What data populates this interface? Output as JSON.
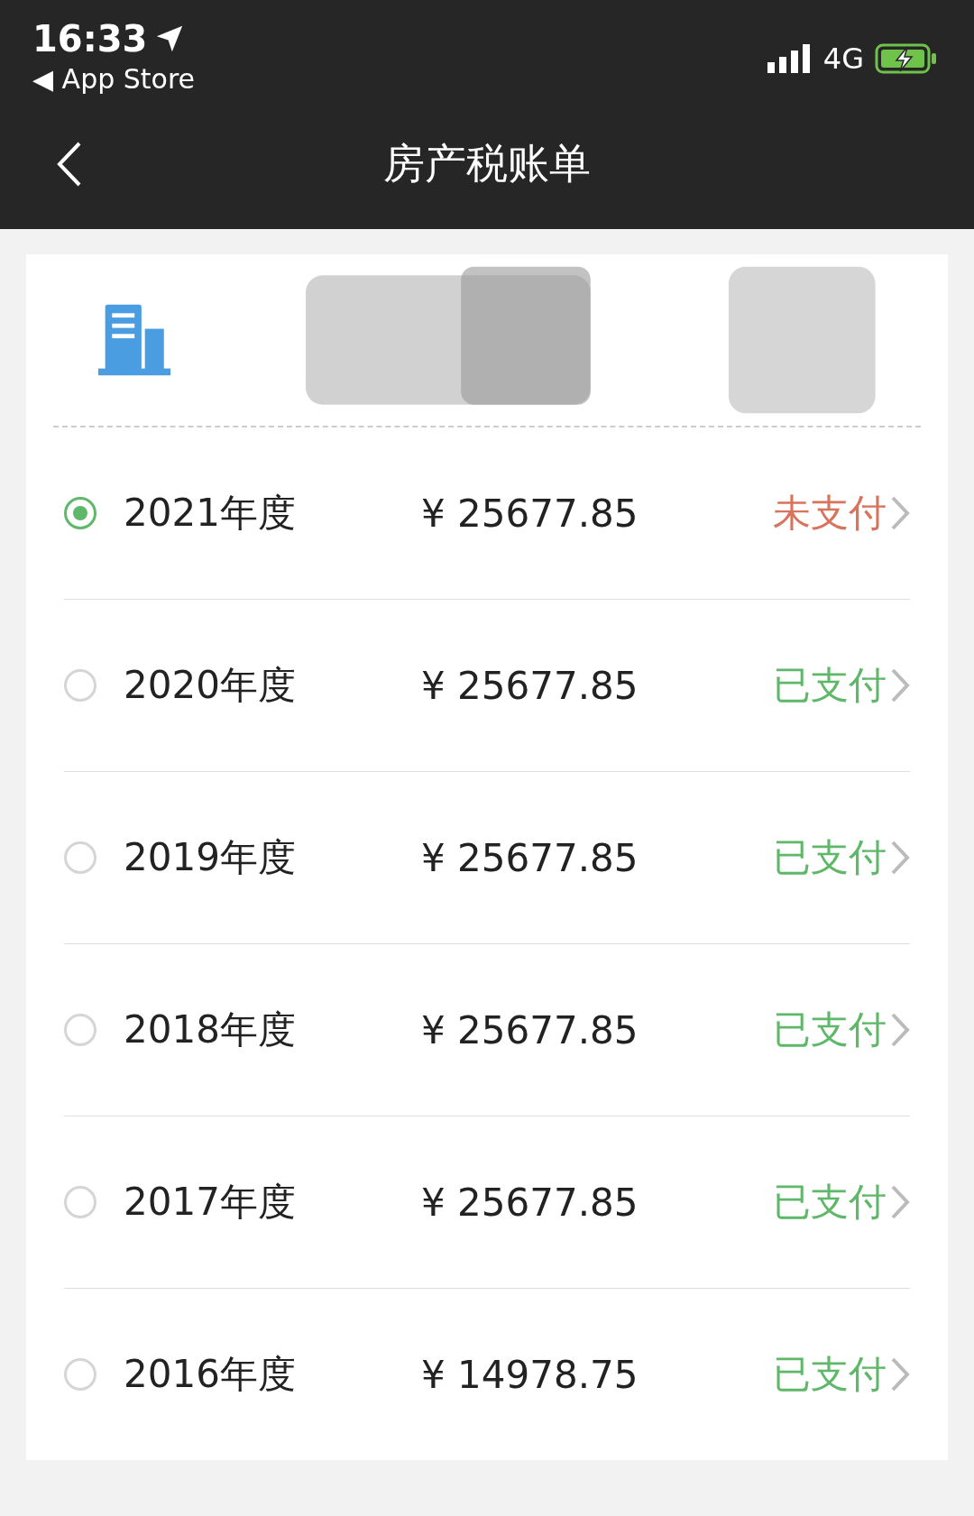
{
  "status_bar": {
    "time": "16:33",
    "back_app": "◀ App Store",
    "network": "4G"
  },
  "nav": {
    "title": "房产税账单"
  },
  "bills": [
    {
      "year": "2021年度",
      "amount": "¥ 25677.85",
      "status": "未支付",
      "color": "#d8735c",
      "selected": true
    },
    {
      "year": "2020年度",
      "amount": "¥ 25677.85",
      "status": "已支付",
      "color": "#5fb86a",
      "selected": false
    },
    {
      "year": "2019年度",
      "amount": "¥ 25677.85",
      "status": "已支付",
      "color": "#5fb86a",
      "selected": false
    },
    {
      "year": "2018年度",
      "amount": "¥ 25677.85",
      "status": "已支付",
      "color": "#5fb86a",
      "selected": false
    },
    {
      "year": "2017年度",
      "amount": "¥ 25677.85",
      "status": "已支付",
      "color": "#5fb86a",
      "selected": false
    },
    {
      "year": "2016年度",
      "amount": "¥ 14978.75",
      "status": "已支付",
      "color": "#5fb86a",
      "selected": false
    }
  ]
}
